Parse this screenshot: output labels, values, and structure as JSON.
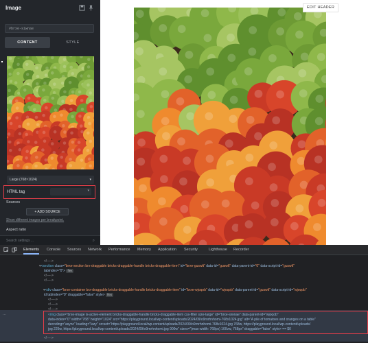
{
  "panel": {
    "title": "Image",
    "id_field": "#brxe-siwnae",
    "tabs": [
      "CONTENT",
      "STYLE"
    ],
    "size_select": "Large (768×1024)",
    "html_tag_label": "HTML tag",
    "sources_label": "Sources",
    "add_source": "+ ADD SOURCE",
    "show_link": "Show different images per breakpoint.",
    "aspect_ratio_label": "Aspect ratio",
    "search_placeholder": "Search settings ..."
  },
  "canvas": {
    "edit_header": "EDIT HEADER"
  },
  "devtools": {
    "tabs": [
      "Elements",
      "Console",
      "Sources",
      "Network",
      "Performance",
      "Memory",
      "Application",
      "Security",
      "Lighthouse",
      "Recorder"
    ],
    "lines": {
      "l1": "<!---->",
      "l2a": "<section ",
      "l2b": "class=",
      "l2c": "\"brxe-section brx-draggable bricks-draggable-handle bricks-draggable-item\"",
      "l2d": " id=",
      "l2e": "\"brxe-guswlt\"",
      "l2f": " data-id=",
      "l2g": "\"guswlt\"",
      "l2h": " data-parent-id=",
      "l2i": "\"0\"",
      "l2j": " data-script-id=",
      "l2k": "\"guswlt\"",
      "l3": "tabindex=\"0\">",
      "l3badge": "flex",
      "l4": "<!---->",
      "l5": "<!---->",
      "l6a": "<div ",
      "l6b": "class=",
      "l6c": "\"brxe-container brx-draggable bricks-draggable-handle bricks-draggable-item\"",
      "l6d": " id=",
      "l6e": "\"brxe-wjoqob\"",
      "l6f": " data-id=",
      "l6g": "\"wjoqob\"",
      "l6h": " data-parent-id=",
      "l6i": "\"guswlt\"",
      "l6j": " data-script-id=",
      "l6k": "\"wjoqob\"",
      "l7": "id tabindex=\"0\" draggable=\"false\" style>",
      "l7badge": "flex",
      "l8": "<!---->",
      "l9": "<!---->",
      "l10": "<!---->",
      "l11a": "<img ",
      "l11b": "class=\"brxe-image is-active-element bricks-draggable-handle bricks-draggable-item css-filter size-large\" id=\"brxe-siwnae\" data-parent-id=\"wjoqob\"",
      "l12": "data-index=\"0\" width=\"768\" height=\"1024\" src=\"https://playground.local/wp-content/uploads/2024/09/o9rnrhnhomi-768x1024.jpg\" alt=\"A pile of tomatoes and oranges on a table\"",
      "l13": "decoding=\"async\" loading=\"lazy\" srcset=\"https://playground.local/wp-content/uploads/2024/09/o9rnrhnhomi-768x1024.jpg 768w, https://playground.local/wp-content/uploads/",
      "l14": "jpg 225w, https://playground.local/wp-content/uploads/2024/09/o9rnrhnhomi.jpg 900w\" sizes=\"(max-width: 768px) 100vw, 768px\" draggable=\"false\" style> == $0",
      "l15": "<!---->"
    }
  }
}
